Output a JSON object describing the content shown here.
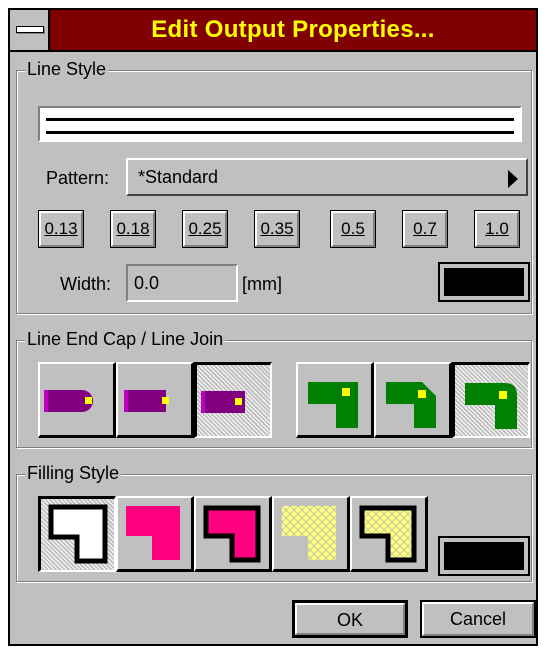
{
  "window": {
    "title": "Edit Output Properties..."
  },
  "line_style": {
    "group_label": "Line Style",
    "pattern_label": "Pattern:",
    "pattern_value": "*Standard",
    "width_buttons": [
      "0.13",
      "0.18",
      "0.25",
      "0.35",
      "0.5",
      "0.7",
      "1.0"
    ],
    "width_label": "Width:",
    "width_value": "0.0",
    "width_unit": "[mm]",
    "color": "#000000"
  },
  "line_end": {
    "group_label": "Line End Cap / Line Join",
    "caps": [
      {
        "name": "round-cap",
        "pressed": false
      },
      {
        "name": "flat-cap",
        "pressed": false
      },
      {
        "name": "square-cap",
        "pressed": true
      }
    ],
    "joins": [
      {
        "name": "miter-join",
        "pressed": false
      },
      {
        "name": "bevel-join",
        "pressed": false
      },
      {
        "name": "round-join",
        "pressed": true
      }
    ],
    "cap_color": "#800080",
    "join_color": "#008000",
    "marker_color": "#ffff00"
  },
  "filling": {
    "group_label": "Filling Style",
    "fill_color": "#000000",
    "pink": "#ff0080",
    "yellow": "#ffff80"
  },
  "buttons": {
    "ok": "OK",
    "cancel": "Cancel"
  }
}
